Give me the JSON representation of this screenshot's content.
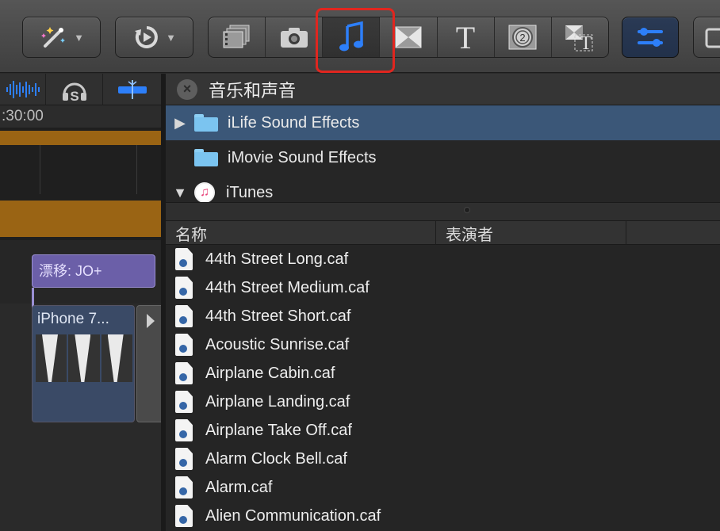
{
  "toolbar": {
    "icons": [
      "magic-wand-icon",
      "retime-icon",
      "clips-icon",
      "photos-icon",
      "music-note-icon",
      "transitions-icon",
      "titles-icon",
      "generators-icon",
      "themes-icon",
      "inspector-icon",
      "share-icon"
    ],
    "active_index": 4,
    "accent_color": "#2d7ff9",
    "highlight_color": "#e0261f"
  },
  "timeline": {
    "timecode": ":30:00",
    "title_clip": "漂移: JO+",
    "video_clip": "iPhone 7..."
  },
  "browser": {
    "title": "音乐和声音",
    "folders": [
      {
        "label": "iLife Sound Effects",
        "selected": true,
        "expandable": true,
        "icon": "folder-icon"
      },
      {
        "label": "iMovie Sound Effects",
        "selected": false,
        "expandable": false,
        "icon": "folder-icon"
      },
      {
        "label": "iTunes",
        "selected": false,
        "expandable": true,
        "icon": "itunes-icon"
      }
    ],
    "columns": {
      "name": "名称",
      "artist": "表演者"
    },
    "files": [
      "44th Street Long.caf",
      "44th Street Medium.caf",
      "44th Street Short.caf",
      "Acoustic Sunrise.caf",
      "Airplane Cabin.caf",
      "Airplane Landing.caf",
      "Airplane Take Off.caf",
      "Alarm Clock Bell.caf",
      "Alarm.caf",
      "Alien Communication.caf"
    ]
  }
}
